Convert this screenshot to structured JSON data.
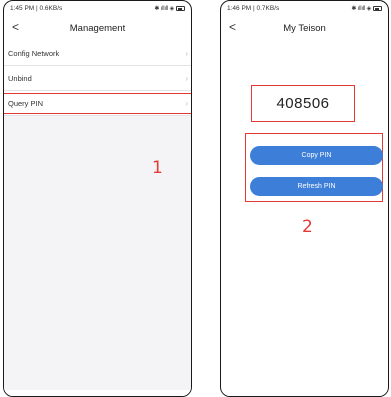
{
  "screen1": {
    "status": {
      "time": "1:45 PM | 0.6KB/s",
      "icons": "✱ ıllıll ◈"
    },
    "nav": {
      "back": "<",
      "title": "Management"
    },
    "menu": [
      {
        "label": "Config Network"
      },
      {
        "label": "Unbind"
      },
      {
        "label": "Query PIN"
      }
    ],
    "step": "1"
  },
  "screen2": {
    "status": {
      "time": "1:46 PM | 0.7KB/s",
      "icons": "✱ ıllıll ◈"
    },
    "nav": {
      "back": "<",
      "title": "My Teison"
    },
    "pin": "408506",
    "copy_label": "Copy PIN",
    "refresh_label": "Refresh PIN",
    "step": "2"
  },
  "colors": {
    "accent_blue": "#3d7ed8",
    "highlight_red": "#e53935"
  },
  "icons": {
    "chevron": "chevron-right-icon",
    "battery": "battery-icon",
    "back": "back-arrow-icon"
  }
}
